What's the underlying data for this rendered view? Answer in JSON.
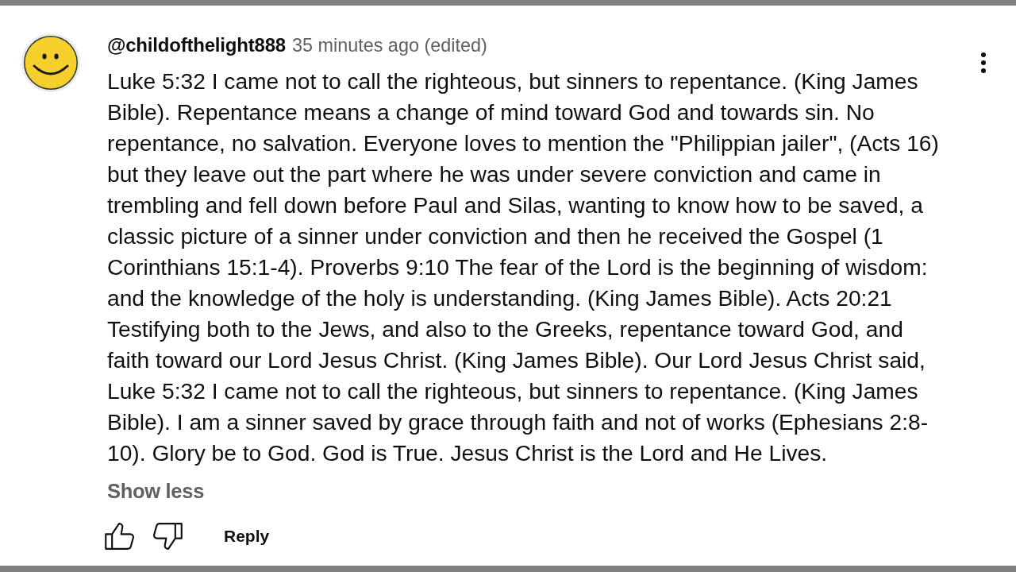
{
  "comment": {
    "author": "@childofthelight888",
    "timestamp": "35 minutes ago (edited)",
    "text": "Luke 5:32 I came not to call the righteous, but sinners to repentance. (King James Bible). Repentance means a change of mind toward God and towards sin. No repentance, no salvation. Everyone loves to mention the \"Philippian jailer\", (Acts 16) but they leave out the part where he was under severe conviction and came in trembling and fell down before Paul and Silas, wanting to know how to be saved, a classic picture of a sinner under conviction and then he received the Gospel (1 Corinthians 15:1-4). Proverbs 9:10 The fear of the Lord is the beginning of wisdom: and the knowledge of the holy is understanding. (King James Bible). Acts 20:21 Testifying both to the Jews, and also to the Greeks, repentance toward God, and faith toward our Lord Jesus Christ. (King James Bible). Our Lord Jesus Christ said, Luke 5:32 I came not to call the righteous, but sinners to repentance. (King James Bible). I am a sinner saved by grace through faith and not of works (Ephesians 2:8-10). Glory be to God. God is True. Jesus Christ is the Lord and He Lives.",
    "show_less": "Show less",
    "reply": "Reply"
  }
}
